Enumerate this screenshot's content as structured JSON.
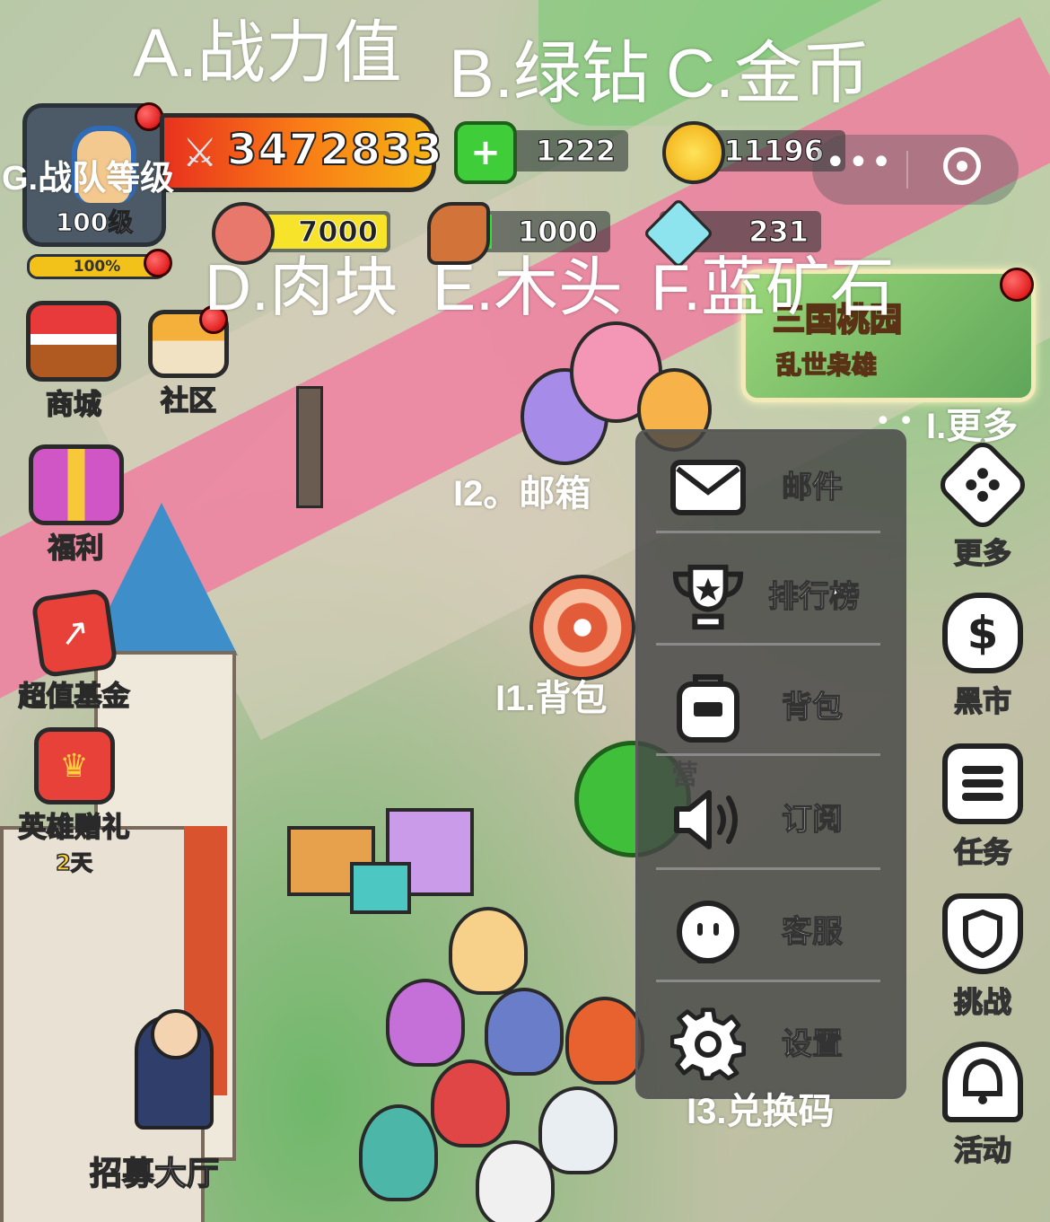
{
  "annotations": {
    "a": "A.战力值",
    "b": "B.绿钻",
    "c": "C.金币",
    "d": "D.肉块",
    "e": "E.木头",
    "f": "F.蓝矿石",
    "g": "G.战队等级",
    "i": "I.更多",
    "i1": "I1.背包",
    "i2": "I2。邮箱",
    "i3": "I3.兑换码"
  },
  "player": {
    "level": "100级",
    "xp_percent": "100%",
    "power": "3472833"
  },
  "resources": {
    "green_diamond": "1222",
    "gold": "11196",
    "meat": "7000",
    "wood": "1000",
    "blue_ore": "231"
  },
  "capsule": {
    "more": "•••"
  },
  "left_menu": {
    "shop": "商城",
    "community": "社区",
    "welfare": "福利",
    "fund": "超值基金",
    "hero_gift": "英雄赠礼",
    "hero_gift_days": "2天"
  },
  "event_banner": {
    "title": "三国桃园",
    "subtitle": "乱世枭雄"
  },
  "dropdown": {
    "items": [
      {
        "label": "邮件",
        "icon": "mail-icon"
      },
      {
        "label": "排行榜",
        "icon": "trophy-icon"
      },
      {
        "label": "背包",
        "icon": "backpack-icon"
      },
      {
        "label": "订阅",
        "icon": "speaker-icon"
      },
      {
        "label": "客服",
        "icon": "headset-icon"
      },
      {
        "label": "设置",
        "icon": "gear-icon"
      }
    ]
  },
  "right_menu": {
    "more": "更多",
    "black_market": "黑市",
    "tasks": "任务",
    "challenge": "挑战",
    "events": "活动"
  },
  "scene": {
    "recruit_hall": "招募大厅",
    "sign_char": "营"
  },
  "colors": {
    "power_bar": "#f97a16",
    "meat_fill": "#f8e32b",
    "wood_fill": "#2ee52b",
    "red_dot": "#d60000",
    "carpet": "#ef7fa0",
    "tower_roof": "#3e8fc9"
  }
}
